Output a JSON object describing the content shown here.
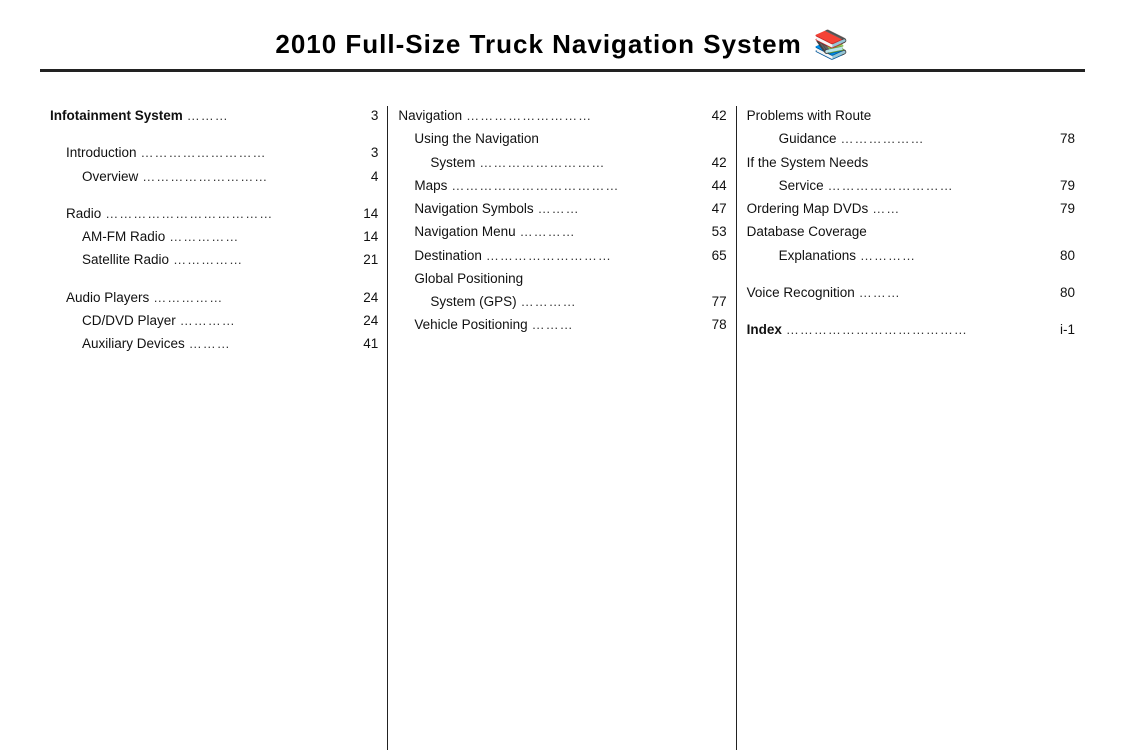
{
  "header": {
    "title": "2010  Full-Size Truck Navigation System",
    "icon": "📖"
  },
  "columns": [
    {
      "id": "col1",
      "entries": [
        {
          "id": "infotainment",
          "title": "Infotainment System",
          "dots": "………",
          "page": "3",
          "bold": true,
          "indent": 0
        },
        {
          "id": "gap1",
          "type": "gap"
        },
        {
          "id": "introduction",
          "title": "Introduction",
          "dots": "………………………",
          "page": "3",
          "bold": false,
          "indent": 1
        },
        {
          "id": "overview",
          "title": "Overview",
          "dots": "………………………",
          "page": "4",
          "bold": false,
          "indent": 2
        },
        {
          "id": "gap2",
          "type": "gap"
        },
        {
          "id": "radio",
          "title": "Radio",
          "dots": "………………………………",
          "page": "14",
          "bold": false,
          "indent": 1
        },
        {
          "id": "amfm",
          "title": "AM-FM Radio",
          "dots": "……………",
          "page": "14",
          "bold": false,
          "indent": 2
        },
        {
          "id": "satellite",
          "title": "Satellite Radio",
          "dots": "……………",
          "page": "21",
          "bold": false,
          "indent": 2
        },
        {
          "id": "gap3",
          "type": "gap"
        },
        {
          "id": "audioplayers",
          "title": "Audio Players",
          "dots": "……………",
          "page": "24",
          "bold": false,
          "indent": 1
        },
        {
          "id": "cddvd",
          "title": "CD/DVD Player",
          "dots": "…………",
          "page": "24",
          "bold": false,
          "indent": 2
        },
        {
          "id": "auxiliary",
          "title": "Auxiliary Devices",
          "dots": "………",
          "page": "41",
          "bold": false,
          "indent": 2
        }
      ]
    },
    {
      "id": "col2",
      "entries": [
        {
          "id": "navigation",
          "title": "Navigation",
          "dots": "………………………",
          "page": "42",
          "bold": false,
          "indent": 0
        },
        {
          "id": "usingnav",
          "title": "Using the Navigation",
          "dots": "",
          "page": "",
          "bold": false,
          "indent": 1
        },
        {
          "id": "system",
          "title": "System",
          "dots": "………………………",
          "page": "42",
          "bold": false,
          "indent": 2
        },
        {
          "id": "maps",
          "title": "Maps",
          "dots": "………………………………",
          "page": "44",
          "bold": false,
          "indent": 1
        },
        {
          "id": "navsymbols",
          "title": "Navigation Symbols",
          "dots": "………",
          "page": "47",
          "bold": false,
          "indent": 1
        },
        {
          "id": "navmenu",
          "title": "Navigation Menu",
          "dots": "…………",
          "page": "53",
          "bold": false,
          "indent": 1
        },
        {
          "id": "destination",
          "title": "Destination",
          "dots": "………………………",
          "page": "65",
          "bold": false,
          "indent": 1
        },
        {
          "id": "globalpositioning",
          "title": "Global Positioning",
          "dots": "",
          "page": "",
          "bold": false,
          "indent": 1
        },
        {
          "id": "gps",
          "title": "System (GPS)",
          "dots": "…………",
          "page": "77",
          "bold": false,
          "indent": 2
        },
        {
          "id": "vehiclepositioning",
          "title": "Vehicle Positioning",
          "dots": "………",
          "page": "78",
          "bold": false,
          "indent": 1
        }
      ]
    },
    {
      "id": "col3",
      "entries": [
        {
          "id": "problemsroute",
          "title": "Problems with Route",
          "dots": "",
          "page": "",
          "bold": false,
          "indent": 0
        },
        {
          "id": "guidance",
          "title": "Guidance",
          "dots": "………………",
          "page": "78",
          "bold": false,
          "indent": 2
        },
        {
          "id": "systemneeds",
          "title": "If the System Needs",
          "dots": "",
          "page": "",
          "bold": false,
          "indent": 0
        },
        {
          "id": "service",
          "title": "Service",
          "dots": "………………………",
          "page": "79",
          "bold": false,
          "indent": 2
        },
        {
          "id": "orderingmap",
          "title": "Ordering Map DVDs",
          "dots": "……",
          "page": "79",
          "bold": false,
          "indent": 0
        },
        {
          "id": "dbcoverage",
          "title": "Database Coverage",
          "dots": "",
          "page": "",
          "bold": false,
          "indent": 0
        },
        {
          "id": "explanations",
          "title": "Explanations",
          "dots": "…………",
          "page": "80",
          "bold": false,
          "indent": 2
        },
        {
          "id": "gap4",
          "type": "gap"
        },
        {
          "id": "voicerecog",
          "title": "Voice Recognition",
          "dots": "………",
          "page": "80",
          "bold": false,
          "indent": 0
        },
        {
          "id": "gap5",
          "type": "gap"
        },
        {
          "id": "index",
          "title": "Index",
          "dots": "…………………………………",
          "page": "i-1",
          "bold": true,
          "indent": 0
        }
      ]
    }
  ]
}
